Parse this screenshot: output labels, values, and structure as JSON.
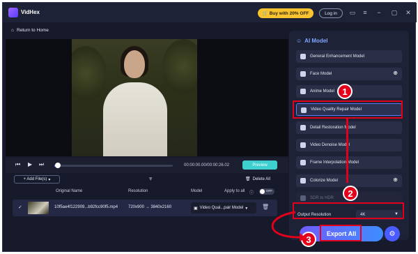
{
  "app": {
    "name": "VidHex",
    "buy_label": "Buy with 20% OFF",
    "login_label": "Log in"
  },
  "breadcrumb": "Return to Home",
  "player": {
    "timecode": "00:00:00.00/00:00:26.02",
    "preview_label": "Preview",
    "progress": 0.02
  },
  "file_list": {
    "add_label": "+ Add File(s)",
    "delete_all_label": "Delete All",
    "columns": {
      "original_name": "Original Name",
      "resolution": "Resolution",
      "model": "Model",
      "apply_all": "Apply to all",
      "toggle": "OFF"
    },
    "rows": [
      {
        "name": "10f5ae4f122909...b92fcc90f5.mp4",
        "resolution": "720x900 → 3840x2160",
        "model": "Video Qual...pair Model"
      }
    ]
  },
  "panel": {
    "title": "AI Model",
    "models": [
      "General Enhancement Model",
      "Face Model",
      "Anime Model",
      "Video Quality Repair Model",
      "Detail Restoration Model",
      "Video Denoise Model",
      "Frame Interpolation Model",
      "Colorize Model",
      "SDR to HDR"
    ],
    "output_label": "Output Resolution",
    "output_value": "4K",
    "export_label": "Export All"
  },
  "annotations": [
    "1",
    "2",
    "3"
  ],
  "colors": {
    "highlight": "#e3001b",
    "accent": "#6f5cff",
    "background": "#171a2b"
  }
}
